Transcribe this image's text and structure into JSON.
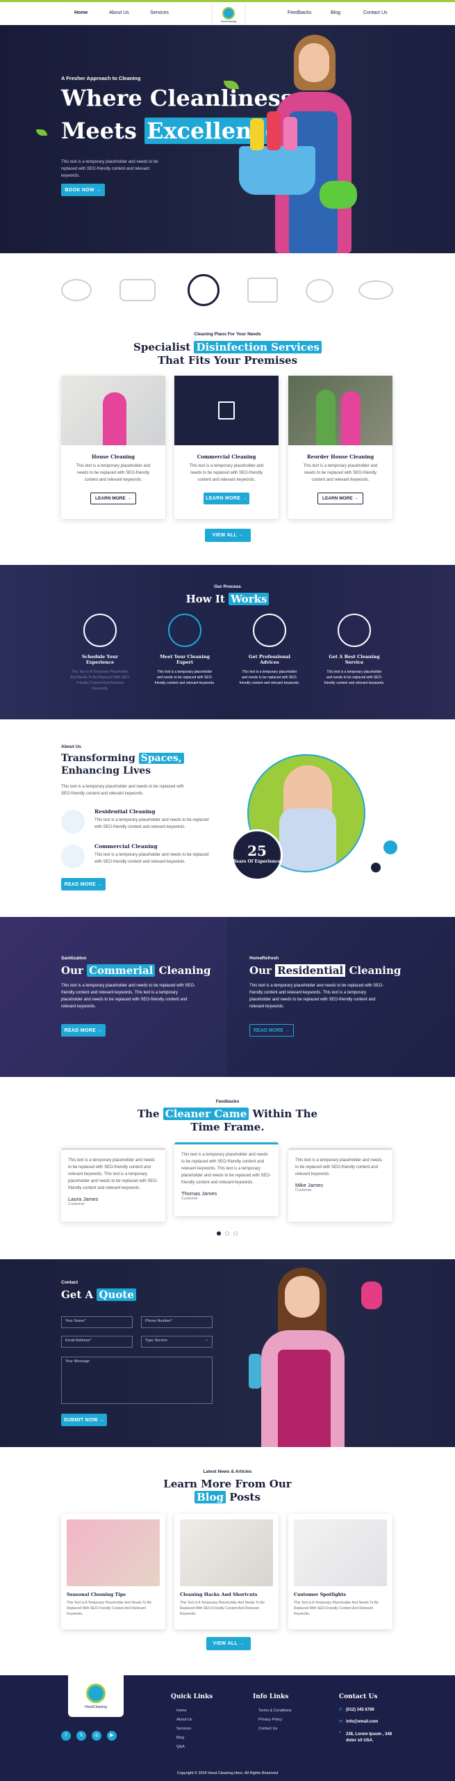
{
  "nav": {
    "items": [
      "Home",
      "About Us",
      "Services",
      "Feedbacks",
      "Blog",
      "Contact Us"
    ],
    "logo_text": "HoodCleaning"
  },
  "hero": {
    "kicker": "A Fresher Approach to Cleaning",
    "title1": "Where Cleanliness",
    "title2a": "Meets",
    "title2b": "Excellence",
    "body": "This text is a temporary placeholder and needs to be replaced with SEO-friendly content and relevant keywords.",
    "button": "BOOK NOW →"
  },
  "services": {
    "kicker": "Cleaning Plans For Your Needs",
    "title_a": "Specialist",
    "title_b": "Disinfection Services",
    "title_c": "That Fits Your Premises",
    "cards": [
      {
        "title": "House Cleaning",
        "body": "This text is a temporary placeholder and needs to be replaced with SEO-friendly content and relevant keywords.",
        "button": "LEARN MORE →"
      },
      {
        "title": "Commercial Cleaning",
        "body": "This text is a temporary placeholder and needs to be replaced with SEO-friendly content and relevant keywords.",
        "button": "LEARN MORE →"
      },
      {
        "title": "Reorder House Cleaning",
        "body": "This text is a temporary placeholder and needs to be replaced with SEO-friendly content and relevant keywords.",
        "button": "LEARN MORE →"
      }
    ],
    "view_all": "VIEW ALL →"
  },
  "process": {
    "kicker": "Our Process",
    "title_a": "How It",
    "title_b": "Works",
    "steps": [
      {
        "title": "Schedule Your Experience",
        "body": "This Text Is A Temporary Placeholder And Needs To Be Replaced With SEO-Friendly Content And Relevant Keywords."
      },
      {
        "title": "Meet Your Cleaning Expert",
        "body": "This text is a temporary placeholder and needs to be replaced with SEO-friendly content and relevant keywords."
      },
      {
        "title": "Get Professional Advices",
        "body": "This text is a temporary placeholder and needs to be replaced with SEO-friendly content and relevant keywords."
      },
      {
        "title": "Get A Best Cleaning Service",
        "body": "This text is a temporary placeholder and needs to be replaced with SEO-friendly content and relevant keywords."
      }
    ]
  },
  "about": {
    "kicker": "About Us",
    "title_a": "Transforming",
    "title_b": "Spaces,",
    "title_c": "Enhancing Lives",
    "body": "This text is a temporary placeholder and needs to be replaced with SEO-friendly content and relevant keywords.",
    "items": [
      {
        "title": "Residential Cleaning",
        "body": "This text is a temporary placeholder and needs to be replaced with SEO-friendly content and relevant keywords."
      },
      {
        "title": "Commercial Cleaning",
        "body": "This text is a temporary placeholder and needs to be replaced with SEO-friendly content and relevant keywords."
      }
    ],
    "button": "READ MORE →",
    "years": "25",
    "years_label": "Years Of Experience"
  },
  "split": {
    "left": {
      "kicker": "Sanitization",
      "a": "Our",
      "b": "Commerial",
      "c": "Cleaning",
      "body": "This text is a temporary placeholder and needs to be replaced with SEO-friendly content and relevant keywords. This text is a temporary placeholder and needs to be replaced with SEO-friendly content and relevant keywords.",
      "button": "READ MORE →"
    },
    "right": {
      "kicker": "HomeRefresh",
      "a": "Our",
      "b": "Residential",
      "c": "Cleaning",
      "body": "This text is a temporary placeholder and needs to be replaced with SEO-friendly content and relevant keywords. This text is a temporary placeholder and needs to be replaced with SEO-friendly content and relevant keywords.",
      "button": "READ MORE →"
    }
  },
  "feedback": {
    "kicker": "Feedbacks",
    "a": "The",
    "b": "Cleaner Came",
    "c": "Within The",
    "d": "Time Frame.",
    "cards": [
      {
        "body": "This text is a temporary placeholder and needs to be replaced with SEO-friendly content and relevant keywords. This text is a temporary placeholder and needs to be replaced with SEO-friendly content and relevant keywords.",
        "name": "Laura James",
        "role": "Customer"
      },
      {
        "body": "This text is a temporary placeholder and needs to be replaced with SEO-friendly content and relevant keywords. This text is a temporary placeholder and needs to be replaced with SEO-friendly content and relevant keywords.",
        "name": "Thomas James",
        "role": "Customer"
      },
      {
        "body": "This text is a temporary placeholder and needs to be replaced with SEO-friendly content and relevant keywords.",
        "name": "Mike James",
        "role": "Customer"
      }
    ]
  },
  "contact": {
    "kicker": "Contact",
    "a": "Get A",
    "b": "Quote",
    "name": "Your Name*",
    "phone": "Phone Number*",
    "email": "Email Address*",
    "type": "Type Service",
    "message": "Your Message",
    "button": "SUBMIT NOW →"
  },
  "news": {
    "kicker": "Latest News & Articles",
    "a": "Learn More From Our",
    "b": "Blog",
    "c": "Posts",
    "cards": [
      {
        "title": "Seasonal Cleaning Tips",
        "body": "This Text Is A Temporary Placeholder And Needs To Be Replaced With SEO-Friendly Content And Relevant Keywords."
      },
      {
        "title": "Cleaning Hacks And Shortcuts",
        "body": "This Text Is A Temporary Placeholder And Needs To Be Replaced With SEO-Friendly Content And Relevant Keywords."
      },
      {
        "title": "Customer Spotlights",
        "body": "This Text Is A Temporary Placeholder And Needs To Be Replaced With SEO-Friendly Content And Relevant Keywords."
      }
    ],
    "view_all": "VIEW ALL →"
  },
  "footer": {
    "quick": "Quick Links",
    "quick_items": [
      "Home",
      "About Us",
      "Services",
      "Blog",
      "Q&A"
    ],
    "info": "Info Links",
    "info_items": [
      "Terms & Conditions",
      "Privacy Policy",
      "Contact Us"
    ],
    "contact": "Contact Us",
    "phone": "(012) 345 6789",
    "email": "info@email.com",
    "address": "238, Lorem Ipsum , 348 dolor sit USA.",
    "copyright": "Copyright © 2024 Hood Cleaning Hero. All Rights Reserved"
  },
  "colors": {
    "accent": "#1fa8d6",
    "navy": "#1a1f3d",
    "green": "#9ccc3c"
  }
}
